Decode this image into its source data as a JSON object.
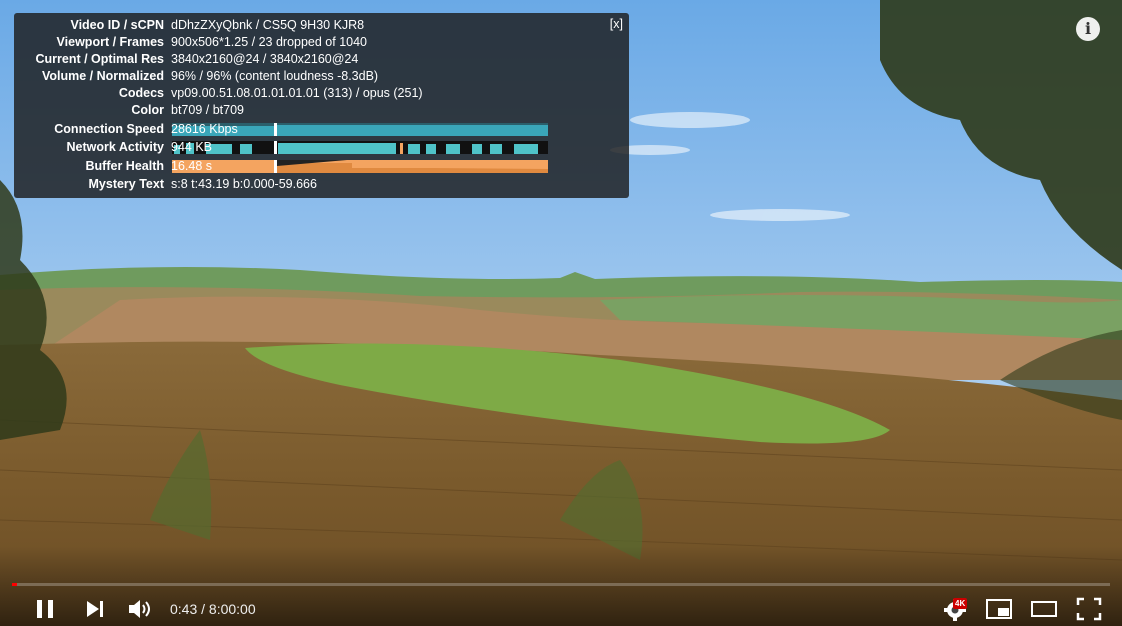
{
  "stats": {
    "close_label": "[x]",
    "rows": [
      {
        "key": "Video ID / sCPN",
        "value": "dDhzZXyQbnk / CS5Q 9H30 KJR8"
      },
      {
        "key": "Viewport / Frames",
        "value": "900x506*1.25 / 23 dropped of 1040"
      },
      {
        "key": "Current / Optimal Res",
        "value": "3840x2160@24 / 3840x2160@24"
      },
      {
        "key": "Volume / Normalized",
        "value": "96% / 96% (content loudness -8.3dB)"
      },
      {
        "key": "Codecs",
        "value": "vp09.00.51.08.01.01.01.01 (313) / opus (251)"
      },
      {
        "key": "Color",
        "value": "bt709 / bt709"
      }
    ],
    "connection_speed": {
      "key": "Connection Speed",
      "value": "28616 Kbps"
    },
    "network_activity": {
      "key": "Network Activity",
      "value": "944 KB"
    },
    "buffer_health": {
      "key": "Buffer Health",
      "value": "16.48 s"
    },
    "mystery_text": {
      "key": "Mystery Text",
      "value": "s:8 t:43.19 b:0.000-59.666"
    },
    "colors": {
      "speed": "#3aa6b9",
      "network": "#4fc3c8",
      "buffer": "#f4a460"
    }
  },
  "controls": {
    "time_current": "0:43",
    "time_total": "8:00:00",
    "time_display": "0:43 / 8:00:00",
    "progress_fraction": 0.0018,
    "quality_badge": "4K",
    "accent": "#ff0000"
  },
  "info_button_label": "i",
  "icons": [
    "info-icon",
    "pause-icon",
    "next-icon",
    "volume-icon",
    "settings-icon",
    "miniplayer-icon",
    "theater-icon",
    "fullscreen-icon"
  ]
}
